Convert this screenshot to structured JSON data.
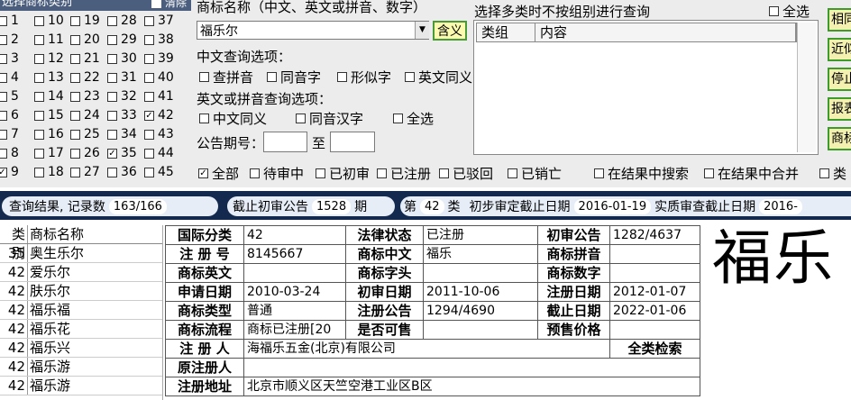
{
  "class_panel": {
    "header": "选择商标类别",
    "clear_label": "清除",
    "rows": [
      [
        "1",
        "10",
        "19",
        "28",
        "37"
      ],
      [
        "2",
        "11",
        "20",
        "29",
        "38"
      ],
      [
        "3",
        "12",
        "21",
        "30",
        "39"
      ],
      [
        "4",
        "13",
        "22",
        "31",
        "40"
      ],
      [
        "5",
        "14",
        "23",
        "32",
        "41"
      ],
      [
        "6",
        "15",
        "24",
        "33",
        "42"
      ],
      [
        "7",
        "16",
        "25",
        "34",
        "43"
      ],
      [
        "8",
        "17",
        "26",
        "35",
        "44"
      ],
      [
        "9",
        "18",
        "27",
        "36",
        "45"
      ]
    ],
    "checked": [
      "9",
      "35",
      "42"
    ]
  },
  "search": {
    "name_label": "商标名称（中文、英文或拼音、数字）",
    "name_value": "福乐尔",
    "meaning_button": "含义",
    "cn_options_label": "中文查询选项：",
    "cn_options": [
      "查拼音",
      "同音字",
      "形似字",
      "英文同义"
    ],
    "en_options_label": "英文或拼音查询选项：",
    "en_options": [
      "中文同义",
      "同音汉字",
      "全选"
    ],
    "gazette_label": "公告期号：",
    "gazette_to": "至",
    "gazette_from_value": "",
    "gazette_to_value": ""
  },
  "multi_class": {
    "title": "选择多类时不按组别进行查询",
    "select_all": "全选",
    "columns": [
      "类组",
      "内容"
    ]
  },
  "side_buttons": [
    "相同",
    "近似",
    "停止",
    "报表",
    "商标"
  ],
  "status_filters": {
    "items": [
      "全部",
      "待审中",
      "已初审",
      "已注册",
      "已驳回",
      "已销亡"
    ],
    "checked": [
      "全部"
    ],
    "extra": [
      "在结果中搜索",
      "在结果中合并",
      "类"
    ]
  },
  "info_bar": {
    "result_label": "查询结果, 记录数",
    "result_count": "163/166",
    "deadline_label": "截止初审公告",
    "deadline_issue": "1528",
    "issue_unit": "期",
    "class_prefix": "第",
    "class_num": "42",
    "class_suffix": "类",
    "prelim_label": "初步审定截止日期",
    "prelim_date": "2016-01-19",
    "subst_label": "实质审查截止日期",
    "subst_date": "2016-"
  },
  "result_list": {
    "columns": [
      "类别",
      "商标名称"
    ],
    "rows": [
      [
        "35",
        "奥生乐尔"
      ],
      [
        "42",
        "爱乐尔"
      ],
      [
        "42",
        "肤乐尔"
      ],
      [
        "42",
        "福乐福"
      ],
      [
        "42",
        "福乐花"
      ],
      [
        "42",
        "福乐兴"
      ],
      [
        "42",
        "福乐游"
      ],
      [
        "42",
        "福乐游"
      ]
    ]
  },
  "detail": {
    "international_class_label": "国际分类",
    "international_class": "42",
    "legal_status_label": "法律状态",
    "legal_status": "已注册",
    "prelim_gazette_label": "初审公告",
    "prelim_gazette": "1282/4637",
    "reg_no_label": "注 册 号",
    "reg_no": "8145667",
    "cn_name_label": "商标中文",
    "cn_name": "福乐",
    "pinyin_label": "商标拼音",
    "pinyin": "",
    "en_name_label": "商标英文",
    "en_name": "",
    "initials_label": "商标字头",
    "initials": "",
    "digits_label": "商标数字",
    "digits": "",
    "apply_date_label": "申请日期",
    "apply_date": "2010-03-24",
    "prelim_date_label": "初审日期",
    "prelim_date": "2011-10-06",
    "reg_date_label": "注册日期",
    "reg_date": "2012-01-07",
    "type_label": "商标类型",
    "type": "普通",
    "reg_gazette_label": "注册公告",
    "reg_gazette": "1294/4690",
    "expiry_label": "截止日期",
    "expiry": "2022-01-06",
    "flow_label": "商标流程",
    "flow": "商标已注册[20",
    "shared_label": "是否可售",
    "shared": "",
    "presale_label": "预售价格",
    "presale": "",
    "registrant_label": "注 册 人",
    "registrant": "海福乐五金(北京)有限公司",
    "full_search": "全类检索",
    "orig_registrant_label": "原注册人",
    "orig_registrant": "",
    "address_label": "注册地址",
    "address": "北京市顺义区天竺空港工业区B区"
  },
  "preview": {
    "text": "福乐"
  }
}
